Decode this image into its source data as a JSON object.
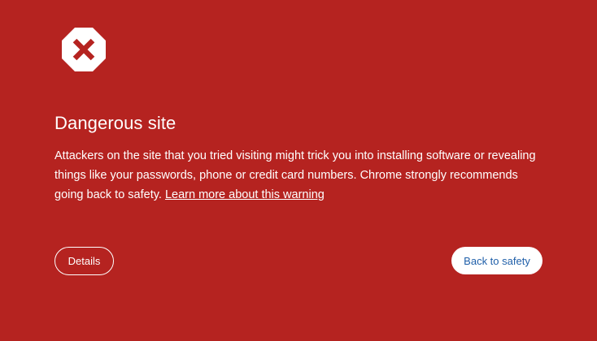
{
  "icon": "danger-octagon-icon",
  "colors": {
    "background": "#b52320",
    "text": "#ffffff",
    "primary_button_text": "#1f5fa9"
  },
  "title": "Dangerous site",
  "message": {
    "body": "Attackers on the site that you tried visiting might trick you into installing software or revealing things like your passwords, phone or credit card numbers. Chrome strongly recommends going back to safety.",
    "learn_more_link": "Learn more about this warning"
  },
  "buttons": {
    "details": "Details",
    "back_to_safety": "Back to safety"
  }
}
